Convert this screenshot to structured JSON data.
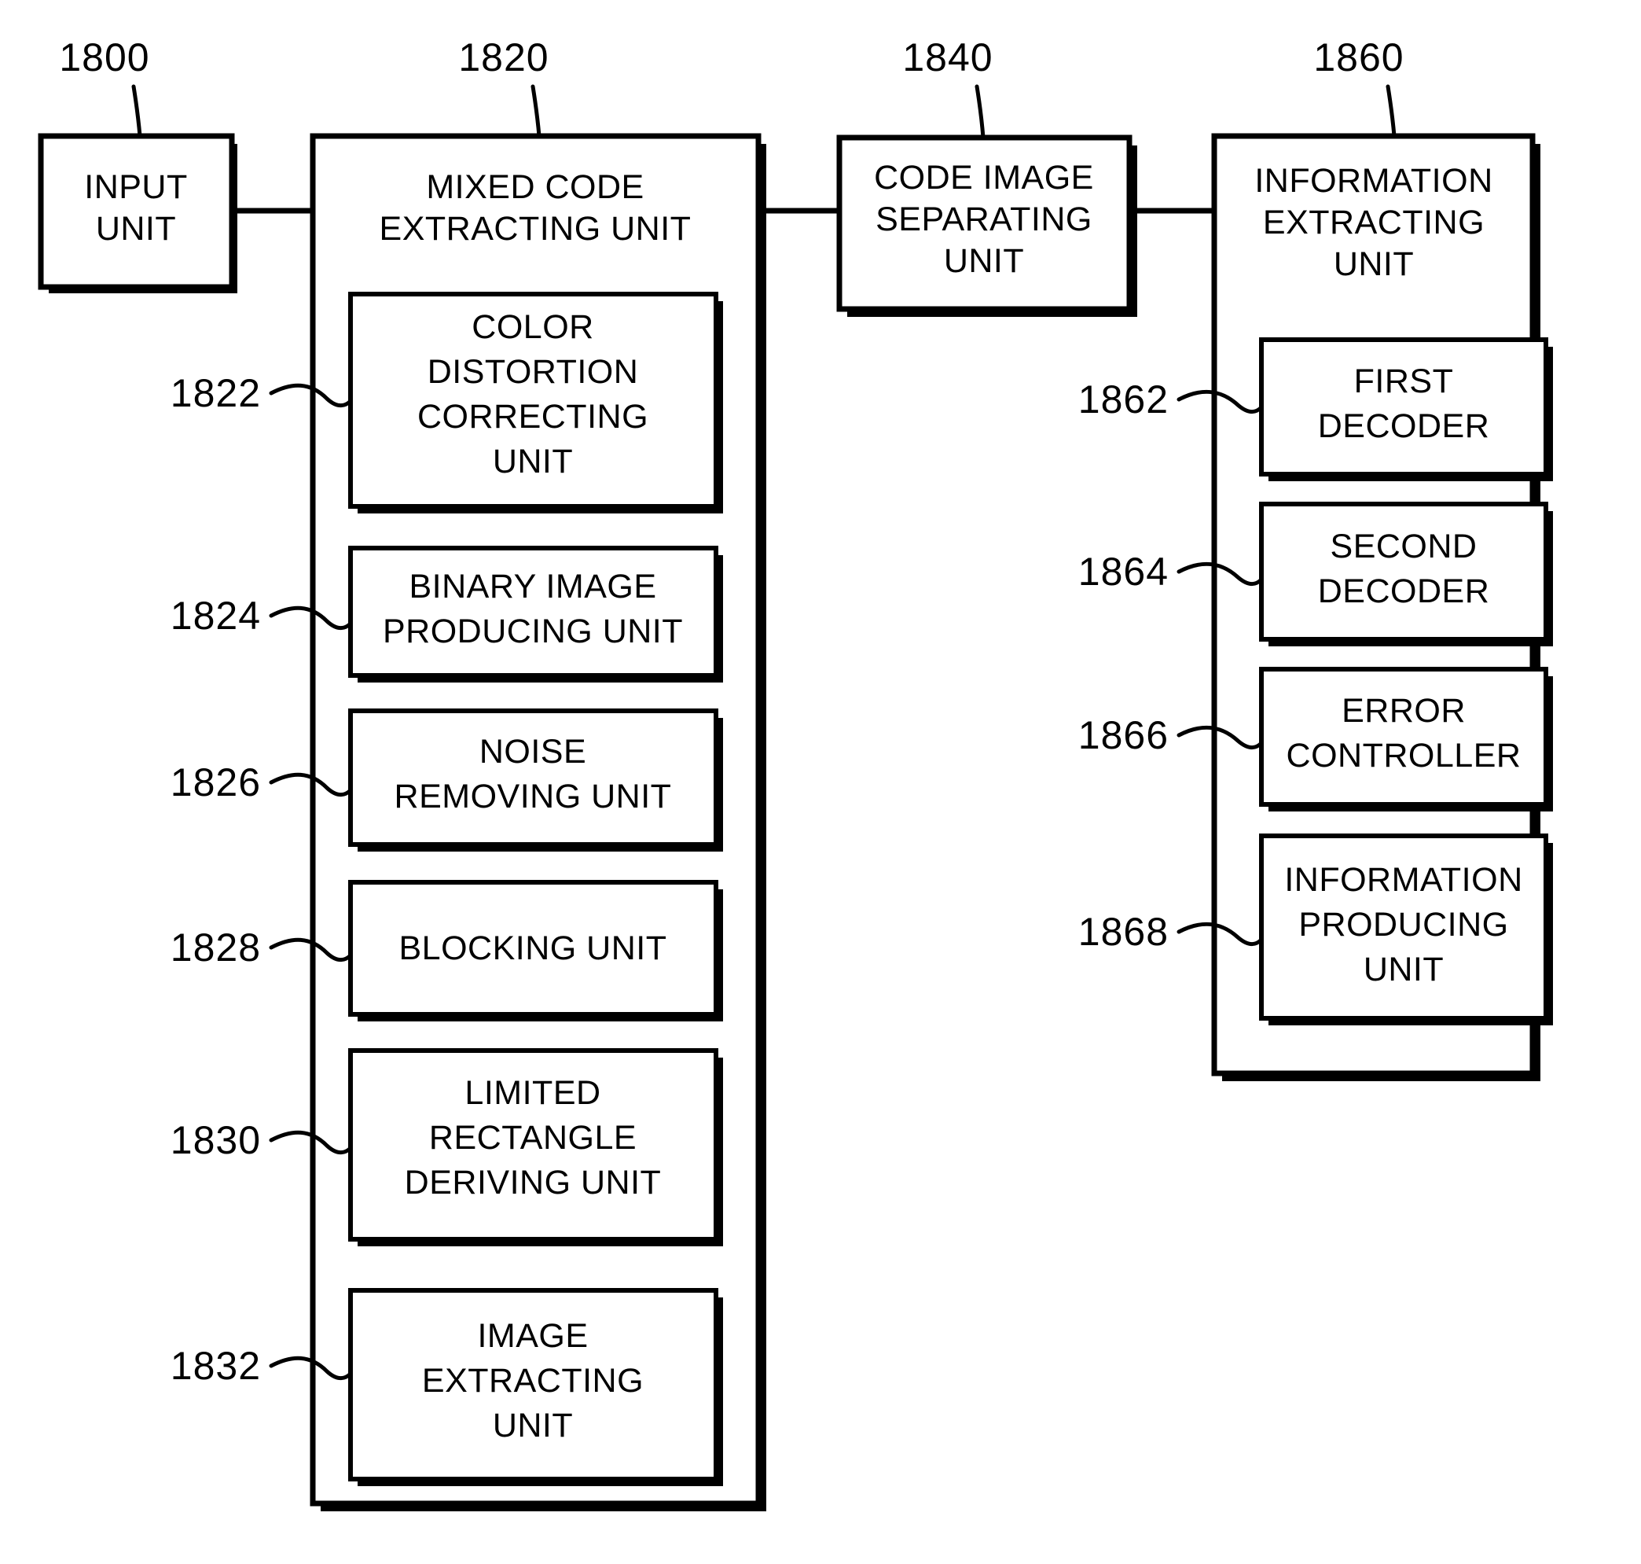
{
  "diagram": {
    "kind": "patent-block-diagram",
    "background_color": "#ffffff",
    "line_color": "#000000",
    "top_reference_numerals": [
      {
        "id": "ref-1800",
        "text": "1800"
      },
      {
        "id": "ref-1820",
        "text": "1820"
      },
      {
        "id": "ref-1840",
        "text": "1840"
      },
      {
        "id": "ref-1860",
        "text": "1860"
      }
    ],
    "blocks": {
      "input_unit": {
        "ref": "1800",
        "lines": [
          "INPUT",
          "UNIT"
        ]
      },
      "mixed_code_extracting_unit": {
        "ref": "1820",
        "lines": [
          "MIXED CODE",
          "EXTRACTING UNIT"
        ],
        "children": [
          {
            "ref": "1822",
            "lines": [
              "COLOR",
              "DISTORTION",
              "CORRECTING",
              "UNIT"
            ]
          },
          {
            "ref": "1824",
            "lines": [
              "BINARY IMAGE",
              "PRODUCING UNIT"
            ]
          },
          {
            "ref": "1826",
            "lines": [
              "NOISE",
              "REMOVING UNIT"
            ]
          },
          {
            "ref": "1828",
            "lines": [
              "BLOCKING UNIT"
            ]
          },
          {
            "ref": "1830",
            "lines": [
              "LIMITED",
              "RECTANGLE",
              "DERIVING UNIT"
            ]
          },
          {
            "ref": "1832",
            "lines": [
              "IMAGE",
              "EXTRACTING",
              "UNIT"
            ]
          }
        ]
      },
      "code_image_separating_unit": {
        "ref": "1840",
        "lines": [
          "CODE IMAGE",
          "SEPARATING",
          "UNIT"
        ]
      },
      "information_extracting_unit": {
        "ref": "1860",
        "lines": [
          "INFORMATION",
          "EXTRACTING",
          "UNIT"
        ],
        "children": [
          {
            "ref": "1862",
            "lines": [
              "FIRST",
              "DECODER"
            ]
          },
          {
            "ref": "1864",
            "lines": [
              "SECOND",
              "DECODER"
            ]
          },
          {
            "ref": "1866",
            "lines": [
              "ERROR",
              "CONTROLLER"
            ]
          },
          {
            "ref": "1868",
            "lines": [
              "INFORMATION",
              "PRODUCING",
              "UNIT"
            ]
          }
        ]
      }
    },
    "connections": [
      {
        "from": "input_unit",
        "to": "mixed_code_extracting_unit"
      },
      {
        "from": "mixed_code_extracting_unit",
        "to": "code_image_separating_unit"
      },
      {
        "from": "code_image_separating_unit",
        "to": "information_extracting_unit"
      }
    ]
  }
}
